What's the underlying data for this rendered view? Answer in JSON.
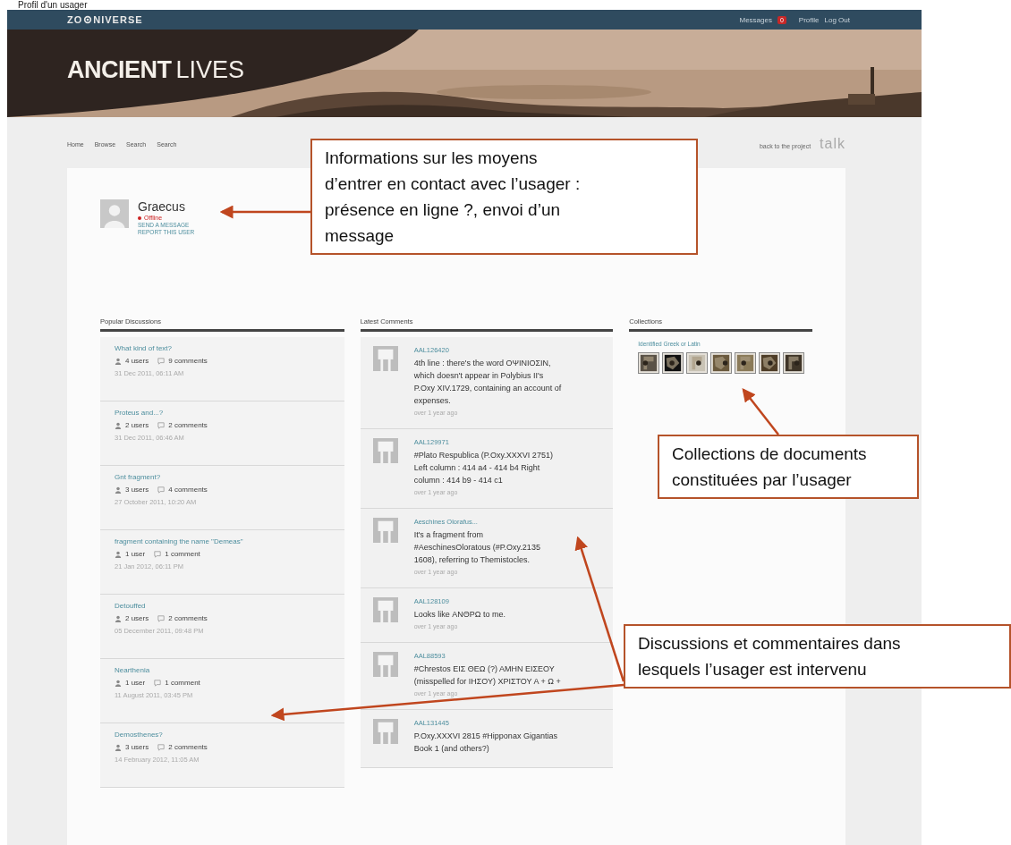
{
  "caption": "Profil d'un usager",
  "topbar": {
    "logo_left": "ZO",
    "logo_right": "NIVERSE",
    "links": [
      {
        "label": "Messages",
        "badge": "0"
      },
      {
        "label": "Profile"
      },
      {
        "label": "Log Out"
      }
    ]
  },
  "banner": {
    "title_bold": "ANCIENT",
    "title_light": "LIVES"
  },
  "nav": {
    "items": [
      "Home",
      "Browse",
      "Search",
      "Search"
    ],
    "back_link": "back to the project",
    "talk": "talk"
  },
  "profile": {
    "name": "Graecus",
    "online": false,
    "status": "Offline",
    "actions": [
      "SEND A MESSAGE",
      "REPORT THIS USER"
    ]
  },
  "popular": {
    "heading": "Popular Discussions",
    "items": [
      {
        "title": "What kind of text?",
        "users": "4 users",
        "comments": "9 comments",
        "date": "31 Dec 2011, 06:11 AM"
      },
      {
        "title": "Proteus and...?",
        "users": "2 users",
        "comments": "2 comments",
        "date": "31 Dec 2011, 06:46 AM"
      },
      {
        "title": "Gnt fragment?",
        "users": "3 users",
        "comments": "4 comments",
        "date": "27 October 2011, 10:20 AM"
      },
      {
        "title": "fragment containing the name \"Demeas\"",
        "users": "1 user",
        "comments": "1 comment",
        "date": "21 Jan 2012, 06:11 PM"
      },
      {
        "title": "Detouffed",
        "users": "2 users",
        "comments": "2 comments",
        "date": "05 December 2011, 09:48 PM"
      },
      {
        "title": "Nearthenia",
        "users": "1 user",
        "comments": "1 comment",
        "date": "11 August 2011, 03:45 PM"
      },
      {
        "title": "Demosthenes?",
        "users": "3 users",
        "comments": "2 comments",
        "date": "14 February 2012, 11:05 AM"
      }
    ]
  },
  "comments": {
    "heading": "Latest Comments",
    "items": [
      {
        "author": "AAL126420",
        "text": "4th line : there's the word ΟΨΙΝΙΟΣΙΝ, which doesn't appear in Polybius II's P.Oxy XIV.1729, containing an account of expenses.",
        "time": "over 1 year ago"
      },
      {
        "author": "AAL129971",
        "text": "#Plato Respublica (P.Oxy.XXXVI 2751) Left column : 414 a4 - 414 b4 Right column : 414 b9 - 414 c1",
        "time": "over 1 year ago"
      },
      {
        "author": "Aeschines Olorafus...",
        "text": "It's a fragment from #AeschinesOloratous (#P.Oxy.2135 1608), referring to Themistocles.",
        "time": "over 1 year ago"
      },
      {
        "author": "AAL128109",
        "text": "Looks like ΑΝΘΡΩ to me.",
        "time": "over 1 year ago"
      },
      {
        "author": "AAL88593",
        "text": "#Chrestos ΕΙΣ ΘΕΩ (?) ΑΜΗΝ ΕΙΣΕΟΥ (misspelled for ΙΗΣΟΥ) ΧΡΙΣΤΟΥ Α + Ω +",
        "time": "over 1 year ago"
      },
      {
        "author": "AAL131445",
        "text": "P.Oxy.XXXVI 2815 #Hipponax Gigantias Book 1 (and others?)"
      }
    ]
  },
  "collections": {
    "heading": "Collections",
    "link": "Identified Greek or Latin"
  },
  "annotations": [
    {
      "lines": [
        "Informations sur les moyens",
        "d’entrer en contact avec l’usager :",
        "présence en ligne ?, envoi d’un",
        "message"
      ]
    },
    {
      "lines": [
        "Collections de documents",
        "constituées par l’usager"
      ]
    },
    {
      "lines": [
        "Discussions et commentaires dans",
        "lesquels l’usager est intervenu"
      ]
    }
  ]
}
